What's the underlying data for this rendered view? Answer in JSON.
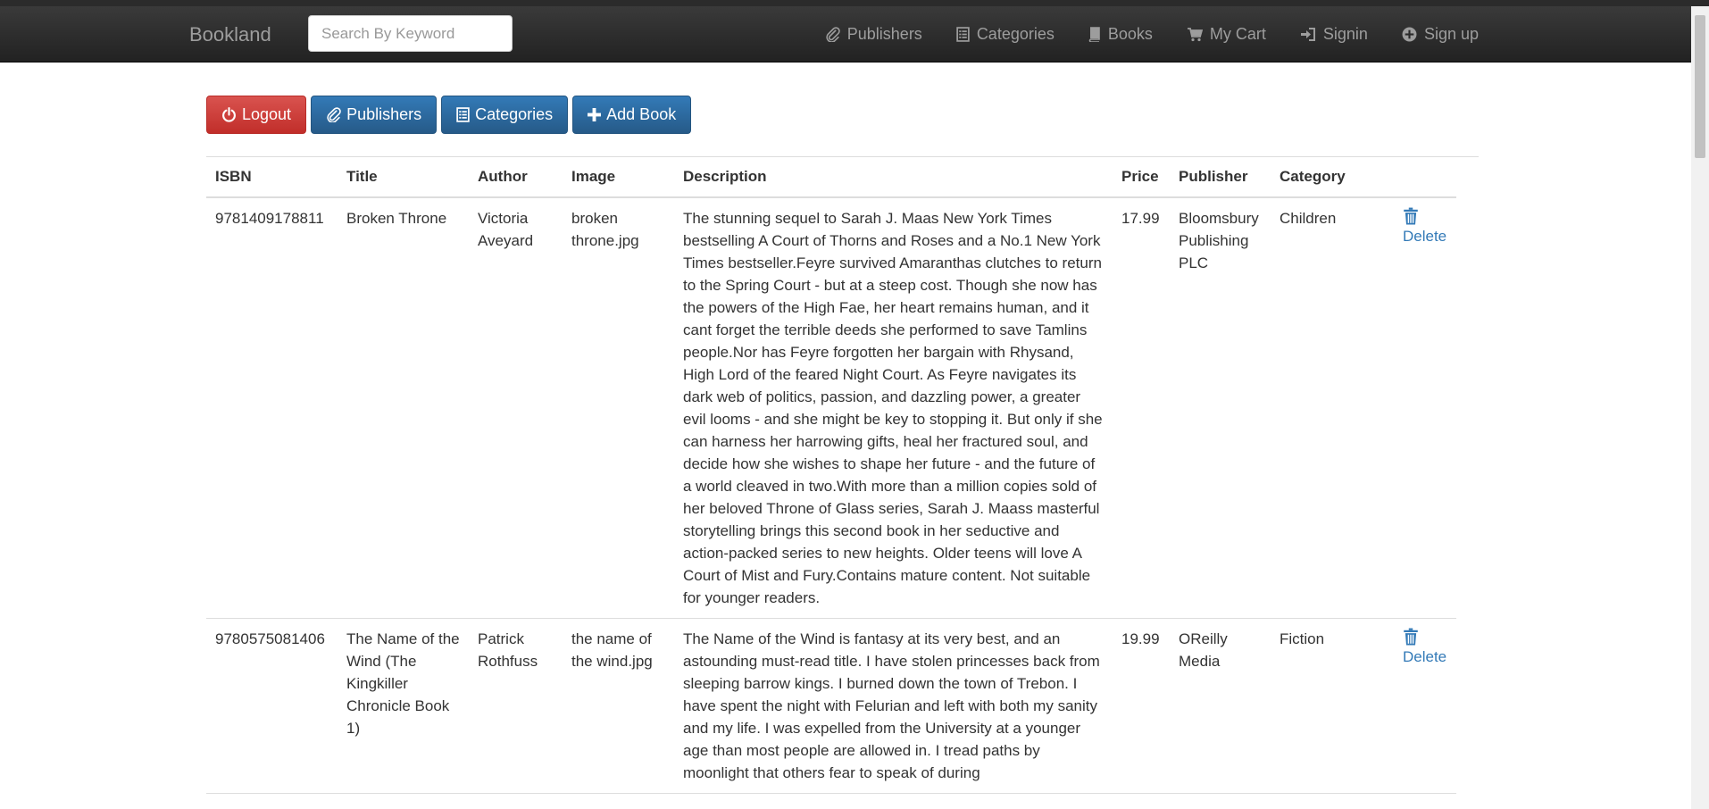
{
  "navbar": {
    "brand": "Bookland",
    "search_placeholder": "Search By Keyword",
    "items": [
      {
        "label": "Publishers",
        "icon": "paperclip-icon"
      },
      {
        "label": "Categories",
        "icon": "list-alt-icon"
      },
      {
        "label": "Books",
        "icon": "book-icon"
      },
      {
        "label": "My Cart",
        "icon": "shopping-cart-icon"
      },
      {
        "label": "Signin",
        "icon": "log-in-icon"
      },
      {
        "label": "Sign up",
        "icon": "plus-sign-icon"
      }
    ]
  },
  "toolbar": {
    "logout": "Logout",
    "publishers": "Publishers",
    "categories": "Categories",
    "add_book": "Add Book"
  },
  "colors": {
    "navbar": "#222222",
    "danger": "#d9534f",
    "primary": "#337ab7",
    "link": "#337ab7"
  },
  "table": {
    "headers": [
      "ISBN",
      "Title",
      "Author",
      "Image",
      "Description",
      "Price",
      "Publisher",
      "Category",
      ""
    ],
    "delete_label": "Delete",
    "rows": [
      {
        "isbn": "9781409178811",
        "title": "Broken Throne",
        "author": "Victoria Aveyard",
        "image": "broken throne.jpg",
        "description": "The stunning sequel to Sarah J. Maas New York Times bestselling A Court of Thorns and Roses and a No.1 New York Times bestseller.Feyre survived Amaranthas clutches to return to the Spring Court - but at a steep cost. Though she now has the powers of the High Fae, her heart remains human, and it cant forget the terrible deeds she performed to save Tamlins people.Nor has Feyre forgotten her bargain with Rhysand, High Lord of the feared Night Court. As Feyre navigates its dark web of politics, passion, and dazzling power, a greater evil looms - and she might be key to stopping it. But only if she can harness her harrowing gifts, heal her fractured soul, and decide how she wishes to shape her future - and the future of a world cleaved in two.With more than a million copies sold of her beloved Throne of Glass series, Sarah J. Maass masterful storytelling brings this second book in her seductive and action-packed series to new heights. Older teens will love A Court of Mist and Fury.Contains mature content. Not suitable for younger readers.",
        "price": "17.99",
        "publisher": "Bloomsbury Publishing PLC",
        "category": "Children"
      },
      {
        "isbn": "9780575081406",
        "title": "The Name of the Wind (The Kingkiller Chronicle Book 1)",
        "author": "Patrick Rothfuss",
        "image": "the name of the wind.jpg",
        "description": "The Name of the Wind is fantasy at its very best, and an astounding must-read title. I have stolen princesses back from sleeping barrow kings. I burned down the town of Trebon. I have spent the night with Felurian and left with both my sanity and my life. I was expelled from the University at a younger age than most people are allowed in. I tread paths by moonlight that others fear to speak of during",
        "price": "19.99",
        "publisher": "OReilly Media",
        "category": "Fiction"
      }
    ]
  }
}
